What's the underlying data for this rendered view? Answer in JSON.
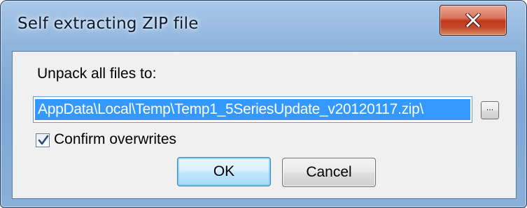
{
  "window": {
    "title": "Self extracting ZIP file",
    "close_icon": "close-icon"
  },
  "dialog": {
    "unpack_label": "Unpack all files to:",
    "path_value": "AppData\\Local\\Temp\\Temp1_5SeriesUpdate_v20120117.zip\\",
    "browse_label": "...",
    "confirm_overwrites": {
      "label": "Confirm overwrites",
      "checked": true
    },
    "ok_label": "OK",
    "cancel_label": "Cancel"
  },
  "colors": {
    "selection": "#3399ff",
    "close_button": "#c2381b",
    "frame": "#8fb4dc"
  }
}
